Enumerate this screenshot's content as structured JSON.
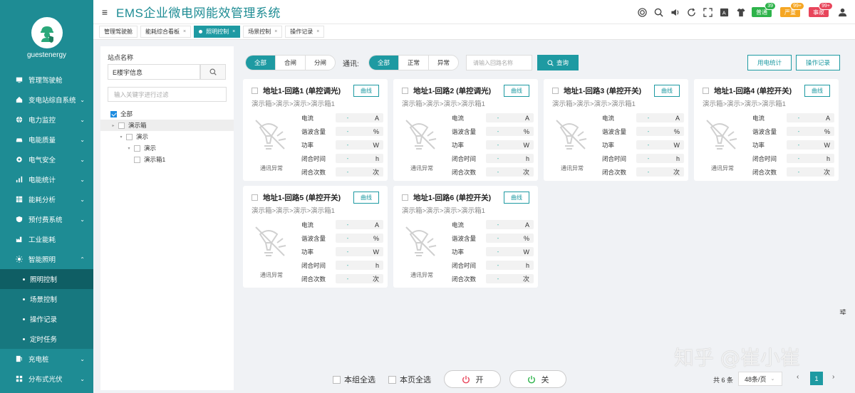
{
  "app": {
    "title": "EMS企业微电网能效管理系统"
  },
  "user": {
    "name": "guestenergy"
  },
  "header_badges": [
    {
      "label": "普通",
      "count": "39",
      "color": "#2db34a"
    },
    {
      "label": "严重",
      "count": "99+",
      "color": "#f5a623"
    },
    {
      "label": "事故",
      "count": "99+",
      "color": "#e8455b"
    }
  ],
  "sidebar": {
    "items": [
      {
        "label": "管理驾驶舱",
        "icon": "monitor-icon"
      },
      {
        "label": "变电站综自系统",
        "icon": "home-icon",
        "caret": "⌄"
      },
      {
        "label": "电力监控",
        "icon": "globe-icon",
        "caret": "⌄"
      },
      {
        "label": "电能质量",
        "icon": "car-icon",
        "caret": "⌄"
      },
      {
        "label": "电气安全",
        "icon": "gear-icon",
        "caret": "⌄"
      },
      {
        "label": "电能统计",
        "icon": "bar-chart-icon",
        "caret": "⌄"
      },
      {
        "label": "能耗分析",
        "icon": "table-icon",
        "caret": "⌄"
      },
      {
        "label": "预付费系统",
        "icon": "shield-icon",
        "caret": "⌄"
      },
      {
        "label": "工业能耗",
        "icon": "factory-icon"
      },
      {
        "label": "智能照明",
        "icon": "sun-icon",
        "caret": "⌃"
      }
    ],
    "sub_items": [
      {
        "label": "照明控制",
        "active": true
      },
      {
        "label": "场景控制"
      },
      {
        "label": "操作记录"
      },
      {
        "label": "定时任务"
      }
    ],
    "items_after": [
      {
        "label": "充电桩",
        "icon": "charger-icon",
        "caret": "⌄"
      },
      {
        "label": "分布式光伏",
        "icon": "grid-icon",
        "caret": "⌄"
      }
    ]
  },
  "tabs": [
    {
      "label": "管理驾驶舱"
    },
    {
      "label": "能耗综合看板"
    },
    {
      "label": "照明控制",
      "active": true
    },
    {
      "label": "场景控制"
    },
    {
      "label": "操作记录"
    }
  ],
  "left_panel": {
    "site_label": "站点名称",
    "site_value": "E楼宇信息",
    "filter_placeholder": "输入关键字进行过滤",
    "tree": [
      {
        "label": "全部",
        "level": 0,
        "checked": true
      },
      {
        "label": "演示箱",
        "level": 0,
        "selected": true,
        "expand": "▸"
      },
      {
        "label": "演示",
        "level": 1,
        "expand": "▾"
      },
      {
        "label": "演示",
        "level": 2,
        "expand": "▾"
      },
      {
        "label": "演示箱1",
        "level": 3
      }
    ]
  },
  "filters": {
    "switch_group": [
      "全部",
      "合闸",
      "分闸"
    ],
    "comm_label": "通讯:",
    "comm_group": [
      "全部",
      "正常",
      "异常"
    ],
    "search_placeholder": "请输入回路名称",
    "query_label": "查询",
    "usage_stats_label": "用电统计",
    "operation_log_label": "操作记录"
  },
  "card_common": {
    "curve_label": "曲线",
    "path": "演示箱>演示>演示>演示箱1",
    "status": "通讯异常",
    "metrics": [
      {
        "name": "电流",
        "value": "-",
        "unit": "A"
      },
      {
        "name": "谐波含量",
        "value": "-",
        "unit": "%"
      },
      {
        "name": "功率",
        "value": "-",
        "unit": "W"
      },
      {
        "name": "闭合时间",
        "value": "-",
        "unit": "h"
      },
      {
        "name": "闭合次数",
        "value": "-",
        "unit": "次"
      }
    ]
  },
  "cards": [
    {
      "title": "地址1-回路1 (单控调光)"
    },
    {
      "title": "地址1-回路2 (单控调光)"
    },
    {
      "title": "地址1-回路3 (单控开关)"
    },
    {
      "title": "地址1-回路4 (单控开关)"
    },
    {
      "title": "地址1-回路5 (单控开关)"
    },
    {
      "title": "地址1-回路6 (单控开关)"
    }
  ],
  "bottom": {
    "select_group_label": "本组全选",
    "select_page_label": "本页全选",
    "on_label": "开",
    "off_label": "关",
    "total": "共 6 条",
    "page_size": "48条/页",
    "current_page": "1"
  },
  "watermark": "知乎 @崔小崔"
}
